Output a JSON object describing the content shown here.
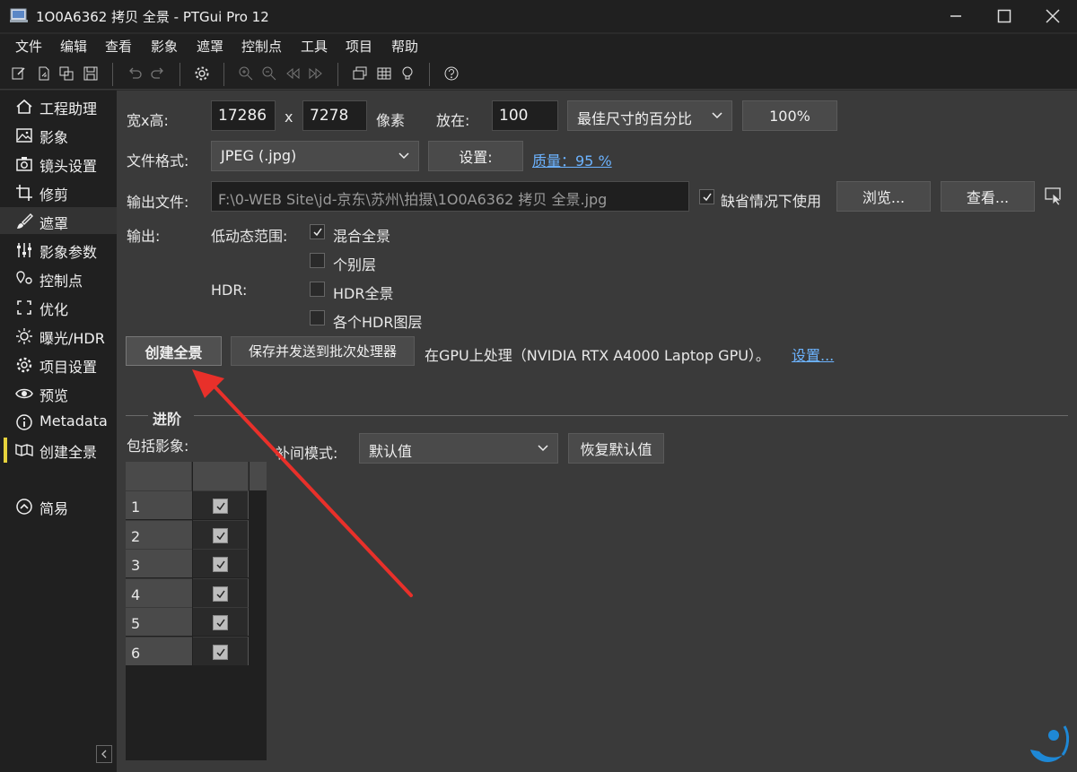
{
  "window": {
    "title": "1O0A6362 拷贝 全景 - PTGui Pro 12"
  },
  "menu": [
    "文件",
    "编辑",
    "查看",
    "影象",
    "遮罩",
    "控制点",
    "工具",
    "项目",
    "帮助"
  ],
  "sidebar": {
    "items": [
      {
        "label": "工程助理",
        "icon": "home-icon"
      },
      {
        "label": "影象",
        "icon": "image-icon"
      },
      {
        "label": "镜头设置",
        "icon": "camera-icon"
      },
      {
        "label": "修剪",
        "icon": "crop-icon"
      },
      {
        "label": "遮罩",
        "icon": "brush-icon"
      },
      {
        "label": "影象参数",
        "icon": "sliders-icon"
      },
      {
        "label": "控制点",
        "icon": "control-points-icon"
      },
      {
        "label": "优化",
        "icon": "optimize-icon"
      },
      {
        "label": "曝光/HDR",
        "icon": "sun-icon"
      },
      {
        "label": "项目设置",
        "icon": "gear-icon"
      },
      {
        "label": "预览",
        "icon": "eye-icon"
      },
      {
        "label": "Metadata",
        "icon": "info-icon"
      },
      {
        "label": "创建全景",
        "icon": "panorama-icon"
      }
    ],
    "simple_label": "简易"
  },
  "size": {
    "label": "宽x高:",
    "width": "17286",
    "x": "x",
    "height": "7278",
    "unit": "像素",
    "scale_label": "放在:",
    "scale_value": "100",
    "scale_mode": "最佳尺寸的百分比",
    "percent_button": "100%"
  },
  "format": {
    "label": "文件格式:",
    "value": "JPEG (.jpg)",
    "settings_button": "设置:",
    "quality_link": "质量：95 %"
  },
  "output_file": {
    "label": "输出文件:",
    "path": "F:\\0-WEB Site\\jd-京东\\苏州\\拍摄\\1O0A6362 拷贝 全景.jpg",
    "default_label": "缺省情况下使用",
    "browse_button": "浏览...",
    "view_button": "查看..."
  },
  "output": {
    "label": "输出:",
    "ldr_label": "低动态范围:",
    "blend_label": "混合全景",
    "layers_label": "个别层",
    "hdr_label": "HDR:",
    "hdr_pano_label": "HDR全景",
    "hdr_layers_label": "各个HDR图层"
  },
  "actions": {
    "create_button": "创建全景",
    "batch_button": "保存并发送到批次处理器",
    "gpu_text": "在GPU上处理（NVIDIA RTX A4000 Laptop GPU）。",
    "gpu_settings_link": "设置..."
  },
  "advanced": {
    "section_label": "进阶",
    "include_label": "包括影象:",
    "interp_label": "补间模式:",
    "interp_value": "默认值",
    "reset_button": "恢复默认值",
    "rows": [
      "1",
      "2",
      "3",
      "4",
      "5",
      "6"
    ]
  },
  "colors": {
    "accent": "#e6d23c",
    "link": "#6cb3ff",
    "annotation_arrow": "#e8302a"
  }
}
